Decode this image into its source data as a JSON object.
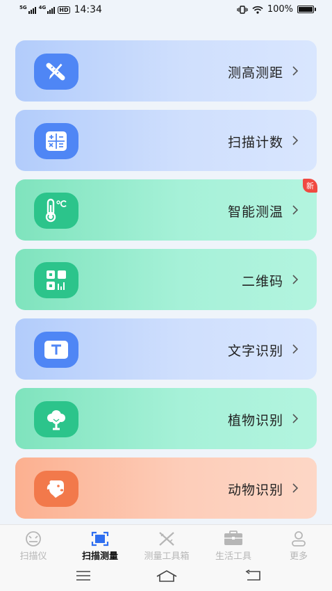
{
  "status_bar": {
    "signal_1_label": "5G",
    "signal_2_label": "4G",
    "hd_label": "HD",
    "time": "14:34",
    "battery_text": "100%",
    "icons": [
      "vibrate-icon",
      "wifi-icon",
      "battery-icon"
    ]
  },
  "cards": [
    {
      "label": "测高测距",
      "icon": "ruler-pencil-icon",
      "color": "blue"
    },
    {
      "label": "扫描计数",
      "icon": "calculator-icon",
      "color": "blue"
    },
    {
      "label": "智能测温",
      "icon": "thermometer-icon",
      "color": "green",
      "badge": "新"
    },
    {
      "label": "二维码",
      "icon": "qr-code-icon",
      "color": "green"
    },
    {
      "label": "文字识别",
      "icon": "text-icon",
      "color": "blue"
    },
    {
      "label": "植物识别",
      "icon": "tree-icon",
      "color": "green"
    },
    {
      "label": "动物识别",
      "icon": "dog-icon",
      "color": "orange"
    }
  ],
  "tabs": [
    {
      "label": "扫描仪",
      "icon": "scanner-icon",
      "active": false
    },
    {
      "label": "扫描测量",
      "icon": "scan-measure-icon",
      "active": true
    },
    {
      "label": "测量工具箱",
      "icon": "tools-icon",
      "active": false
    },
    {
      "label": "生活工具",
      "icon": "toolbox-icon",
      "active": false
    },
    {
      "label": "更多",
      "icon": "user-icon",
      "active": false
    }
  ],
  "colors": {
    "blue_icon": "#4f86f5",
    "green_icon": "#2cc48b",
    "orange_icon": "#f2794b",
    "badge": "#f04a41",
    "tab_active": "#111111",
    "tab_inactive": "#b6b6b6"
  }
}
